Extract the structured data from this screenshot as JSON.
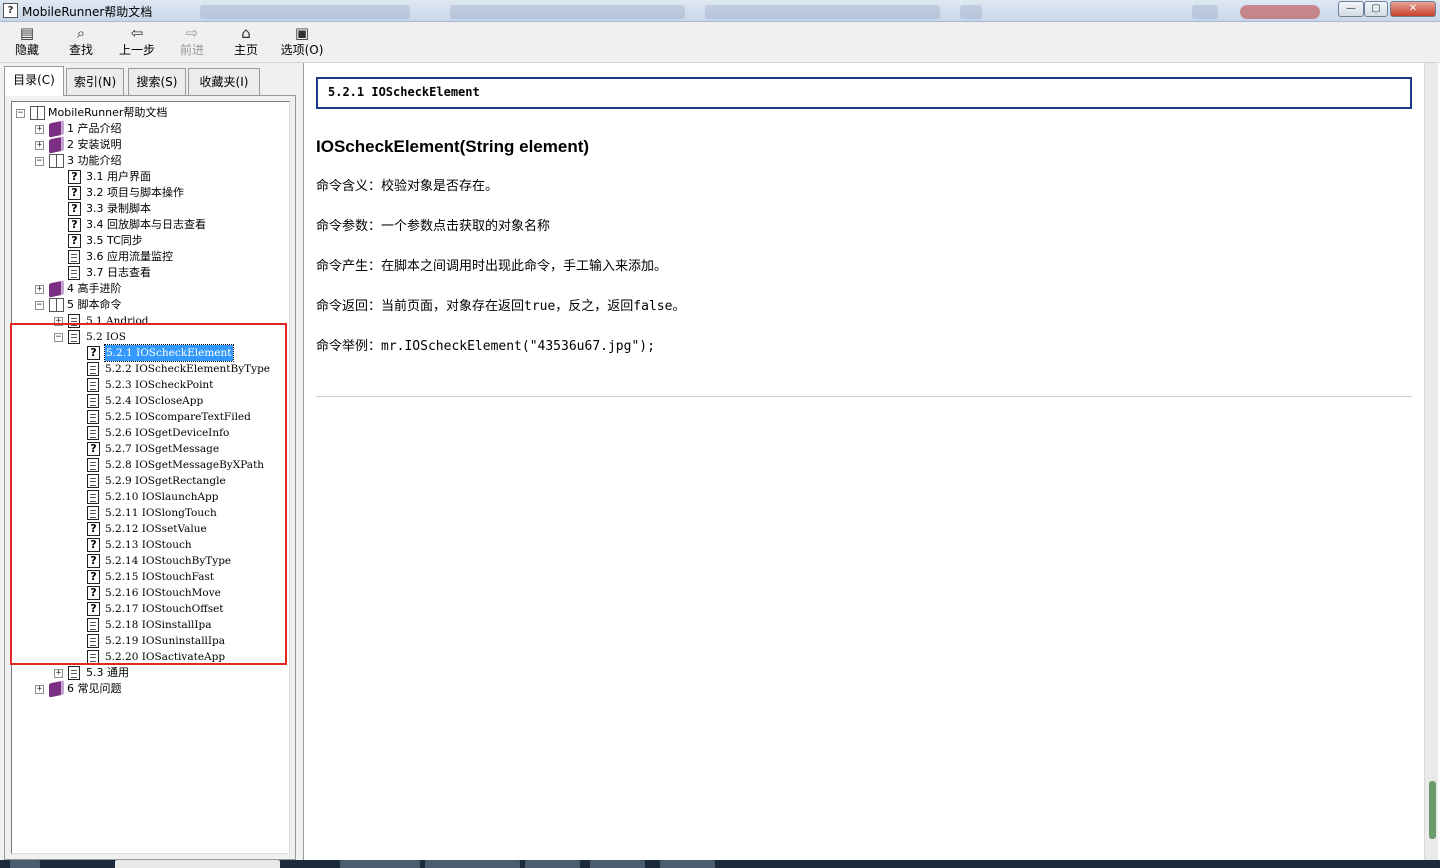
{
  "window": {
    "title": "MobileRunner帮助文档",
    "icon": "help-file-icon"
  },
  "window_controls": {
    "minimize": "—",
    "maximize": "▢",
    "close": "✕"
  },
  "toolbar": [
    {
      "id": "hide",
      "label": "隐藏",
      "icon": "hide-pane-icon",
      "glyph": "▤",
      "enabled": true
    },
    {
      "id": "find",
      "label": "查找",
      "icon": "find-icon",
      "glyph": "⌕",
      "enabled": true
    },
    {
      "id": "back",
      "label": "上一步",
      "icon": "back-arrow-icon",
      "glyph": "⇦",
      "enabled": true
    },
    {
      "id": "forward",
      "label": "前进",
      "icon": "forward-arrow-icon",
      "glyph": "⇨",
      "enabled": false
    },
    {
      "id": "home",
      "label": "主页",
      "icon": "home-icon",
      "glyph": "⌂",
      "enabled": true
    },
    {
      "id": "options",
      "label": "选项(O)",
      "icon": "options-icon",
      "glyph": "▣",
      "enabled": true
    }
  ],
  "left_tabs": [
    {
      "label": "目录(C)",
      "active": true
    },
    {
      "label": "索引(N)",
      "active": false
    },
    {
      "label": "搜索(S)",
      "active": false
    },
    {
      "label": "收藏夹(I)",
      "active": false
    }
  ],
  "tree": [
    {
      "text": "MobileRunner帮助文档",
      "level": 0,
      "icon": "book-open",
      "expander": "−"
    },
    {
      "text": "1 产品介绍",
      "level": 1,
      "icon": "book-closed",
      "expander": "+"
    },
    {
      "text": "2 安装说明",
      "level": 1,
      "icon": "book-closed",
      "expander": "+"
    },
    {
      "text": "3 功能介绍",
      "level": 1,
      "icon": "book-open",
      "expander": "−"
    },
    {
      "text": "3.1 用户界面",
      "level": 2,
      "icon": "help-topic"
    },
    {
      "text": "3.2 项目与脚本操作",
      "level": 2,
      "icon": "help-topic"
    },
    {
      "text": "3.3 录制脚本",
      "level": 2,
      "icon": "help-topic"
    },
    {
      "text": "3.4 回放脚本与日志查看",
      "level": 2,
      "icon": "help-topic"
    },
    {
      "text": "3.5 TC同步",
      "level": 2,
      "icon": "help-topic"
    },
    {
      "text": "3.6 应用流量监控",
      "level": 2,
      "icon": "page"
    },
    {
      "text": "3.7 日志查看",
      "level": 2,
      "icon": "page"
    },
    {
      "text": "4 高手进阶",
      "level": 1,
      "icon": "book-closed",
      "expander": "+"
    },
    {
      "text": "5 脚本命令",
      "level": 1,
      "icon": "book-open",
      "expander": "−"
    },
    {
      "text": "5.1 Andriod",
      "level": 2,
      "icon": "page",
      "expander": "+",
      "mono": true
    },
    {
      "text": "5.2 IOS",
      "level": 2,
      "icon": "page",
      "expander": "−",
      "mono": true
    },
    {
      "text": "5.2.1 IOScheckElement",
      "level": 3,
      "icon": "help-topic",
      "selected": true,
      "mono": true
    },
    {
      "text": "5.2.2 IOScheckElementByType",
      "level": 3,
      "icon": "page",
      "mono": true
    },
    {
      "text": "5.2.3 IOScheckPoint",
      "level": 3,
      "icon": "page",
      "mono": true
    },
    {
      "text": "5.2.4 IOScloseApp",
      "level": 3,
      "icon": "page",
      "mono": true
    },
    {
      "text": "5.2.5 IOScompareTextFiled",
      "level": 3,
      "icon": "page",
      "mono": true
    },
    {
      "text": "5.2.6 IOSgetDeviceInfo",
      "level": 3,
      "icon": "page",
      "mono": true
    },
    {
      "text": "5.2.7 IOSgetMessage",
      "level": 3,
      "icon": "help-topic",
      "mono": true
    },
    {
      "text": "5.2.8 IOSgetMessageByXPath",
      "level": 3,
      "icon": "page",
      "mono": true
    },
    {
      "text": "5.2.9 IOSgetRectangle",
      "level": 3,
      "icon": "page",
      "mono": true
    },
    {
      "text": "5.2.10 IOSlaunchApp",
      "level": 3,
      "icon": "page",
      "mono": true
    },
    {
      "text": "5.2.11 IOSlongTouch",
      "level": 3,
      "icon": "page",
      "mono": true
    },
    {
      "text": "5.2.12 IOSsetValue",
      "level": 3,
      "icon": "help-topic",
      "mono": true
    },
    {
      "text": "5.2.13 IOStouch",
      "level": 3,
      "icon": "help-topic",
      "mono": true
    },
    {
      "text": "5.2.14 IOStouchByType",
      "level": 3,
      "icon": "help-topic",
      "mono": true
    },
    {
      "text": "5.2.15 IOStouchFast",
      "level": 3,
      "icon": "help-topic",
      "mono": true
    },
    {
      "text": "5.2.16 IOStouchMove",
      "level": 3,
      "icon": "help-topic",
      "mono": true
    },
    {
      "text": "5.2.17 IOStouchOffset",
      "level": 3,
      "icon": "help-topic",
      "mono": true
    },
    {
      "text": "5.2.18 IOSinstallIpa",
      "level": 3,
      "icon": "page",
      "mono": true
    },
    {
      "text": "5.2.19 IOSuninstallIpa",
      "level": 3,
      "icon": "page",
      "mono": true
    },
    {
      "text": "5.2.20 IOSactivateApp",
      "level": 3,
      "icon": "page",
      "mono": true
    },
    {
      "text": "5.3 通用",
      "level": 2,
      "icon": "page",
      "expander": "+"
    },
    {
      "text": "6 常见问题",
      "level": 1,
      "icon": "book-closed",
      "expander": "+"
    }
  ],
  "content": {
    "header": "5.2.1 IOScheckElement",
    "heading": "IOScheckElement(String element)",
    "lines": [
      "命令含义：校验对象是否存在。",
      "命令参数：一个参数点击获取的对象名称",
      "命令产生：在脚本之间调用时出现此命令，手工输入来添加。",
      "命令返回：当前页面，对象存在返回true，反之，返回false。",
      "命令举例：mr.IOScheckElement(\"43536u67.jpg\");"
    ]
  },
  "colors": {
    "selection": "#3399ff",
    "highlight_border": "#e0281f",
    "header_border": "#1a3b8a",
    "closed_book": "#7b2f83"
  }
}
